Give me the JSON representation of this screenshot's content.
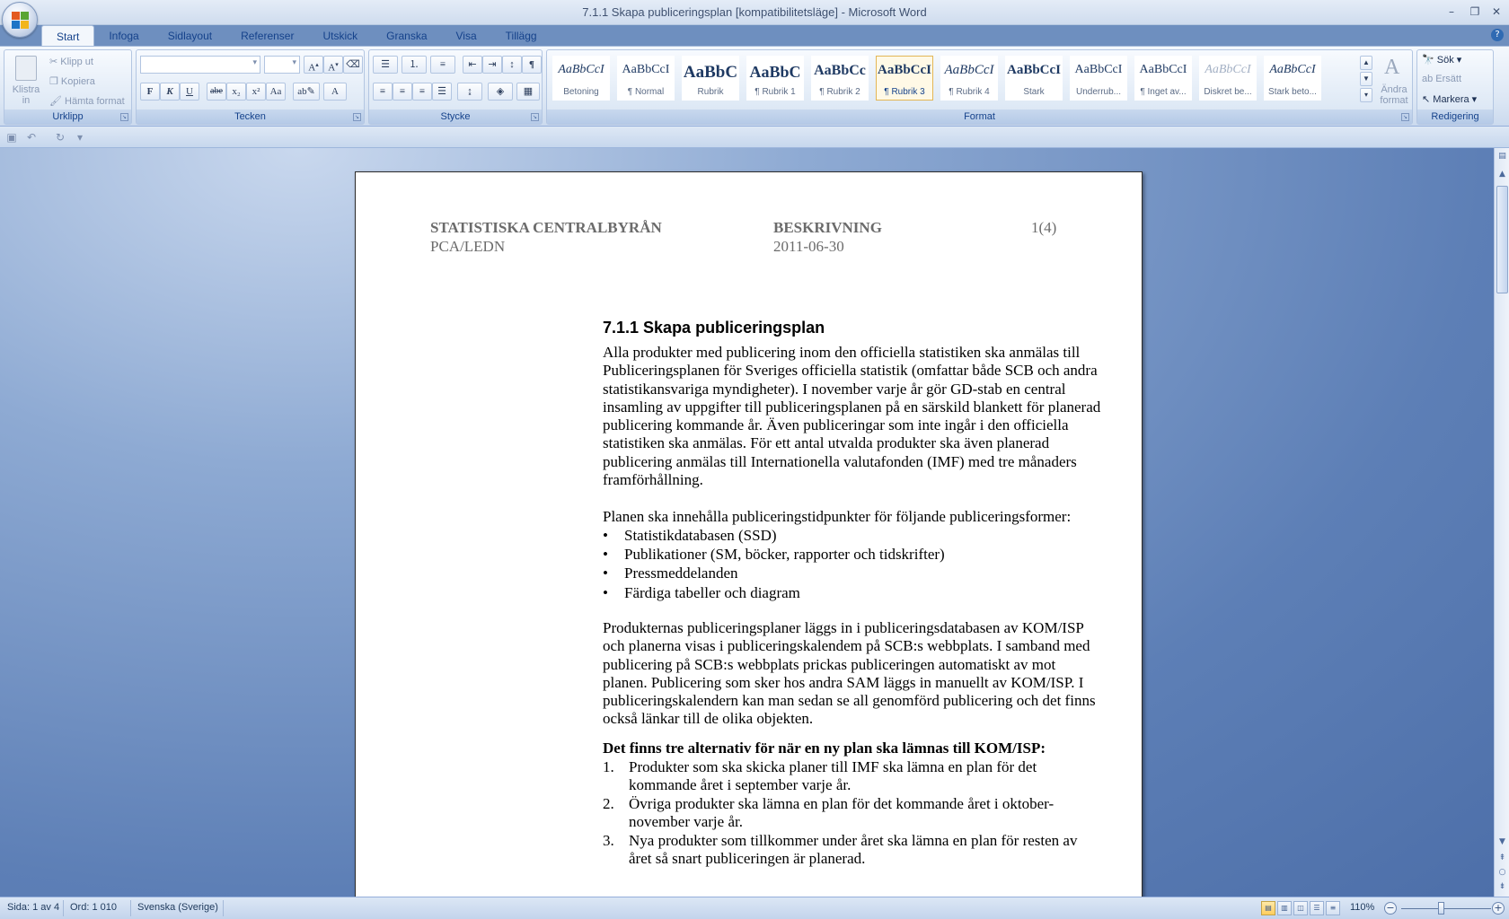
{
  "window": {
    "title": "7.1.1 Skapa publiceringsplan [kompatibilitetsläge] - Microsoft Word"
  },
  "tabs": [
    "Start",
    "Infoga",
    "Sidlayout",
    "Referenser",
    "Utskick",
    "Granska",
    "Visa",
    "Tillägg"
  ],
  "ribbon": {
    "clipboard": {
      "label": "Urklipp",
      "paste": "Klistra in",
      "cut": "Klipp ut",
      "copy": "Kopiera",
      "format_painter": "Hämta format"
    },
    "font": {
      "label": "Tecken",
      "bold": "F",
      "italic": "K",
      "underline": "U",
      "strike": "abe",
      "sub": "x₂",
      "sup": "x²",
      "case": "Aa"
    },
    "paragraph": {
      "label": "Stycke"
    },
    "styles": {
      "label": "Format",
      "items": [
        {
          "preview": "AaBbCcI",
          "name": "Betoning"
        },
        {
          "preview": "AaBbCcI",
          "name": "¶ Normal"
        },
        {
          "preview": "AaBbC",
          "name": "Rubrik"
        },
        {
          "preview": "AaBbC",
          "name": "¶ Rubrik 1"
        },
        {
          "preview": "AaBbCc",
          "name": "¶ Rubrik 2"
        },
        {
          "preview": "AaBbCcI",
          "name": "¶ Rubrik 3"
        },
        {
          "preview": "AaBbCcI",
          "name": "¶ Rubrik 4"
        },
        {
          "preview": "AaBbCcI",
          "name": "Stark"
        },
        {
          "preview": "AaBbCcI",
          "name": "Underrub..."
        },
        {
          "preview": "AaBbCcI",
          "name": "¶ Inget av..."
        },
        {
          "preview": "AaBbCcI",
          "name": "Diskret be..."
        },
        {
          "preview": "AaBbCcI",
          "name": "Stark beto..."
        }
      ],
      "change_styles": "Ändra format"
    },
    "editing": {
      "label": "Redigering",
      "find": "Sök",
      "replace": "Ersätt",
      "select": "Markera"
    }
  },
  "document": {
    "header": {
      "org": "STATISTISKA CENTRALBYRÅN",
      "dept": "PCA/LEDN",
      "doctype": "BESKRIVNING",
      "date": "2011-06-30",
      "page": "1(4)"
    },
    "heading": "7.1.1 Skapa publiceringsplan",
    "para1": "Alla produkter med publicering inom den officiella statistiken ska anmälas till Publiceringsplanen för Sveriges officiella statistik (omfattar både SCB och andra statistikansvariga myndigheter). I november varje år gör GD-stab en central insamling av uppgifter till publiceringsplanen på en särskild blankett för planerad publicering kommande år. Även publiceringar som inte ingår i den officiella statistiken ska anmälas. För ett antal utvalda produkter ska även planerad publicering anmälas till Internationella valutafonden (IMF) med tre månaders framförhållning.",
    "para2_intro": "Planen ska innehålla publiceringstidpunkter för följande publiceringsformer:",
    "bullets": [
      "Statistikdatabasen (SSD)",
      "Publikationer (SM, böcker, rapporter och tidskrifter)",
      "Pressmeddelanden",
      "Färdiga tabeller och diagram"
    ],
    "para3": "Produkternas publiceringsplaner läggs in i publiceringsdatabasen av KOM/ISP och planerna visas i publiceringskalendem på SCB:s webbplats. I samband med publicering på SCB:s webbplats prickas publiceringen automatiskt av mot planen. Publicering som sker hos andra SAM läggs in manuellt av KOM/ISP. I publiceringskalendern kan man sedan se all genomförd publicering och det finns också länkar till de olika objekten.",
    "bold_heading": "Det finns tre alternativ för när en ny plan ska lämnas till KOM/ISP:",
    "numbered": [
      {
        "n": "1.",
        "text": "Produkter som ska skicka planer till IMF ska lämna en plan för det kommande året i september varje år."
      },
      {
        "n": "2.",
        "text": "Övriga produkter ska lämna en plan för det kommande året i oktober-november varje år."
      },
      {
        "n": "3.",
        "text": "Nya produkter som tillkommer under året ska lämna en plan för resten av året så snart publiceringen är planerad."
      }
    ]
  },
  "status": {
    "page": "Sida: 1 av 4",
    "words": "Ord: 1 010",
    "language": "Svenska (Sverige)",
    "zoom": "110%"
  },
  "colors": {
    "ribbon_text": "#15428b",
    "workspace": "#6e8fbf",
    "selected_style_border": "#e3b655"
  }
}
